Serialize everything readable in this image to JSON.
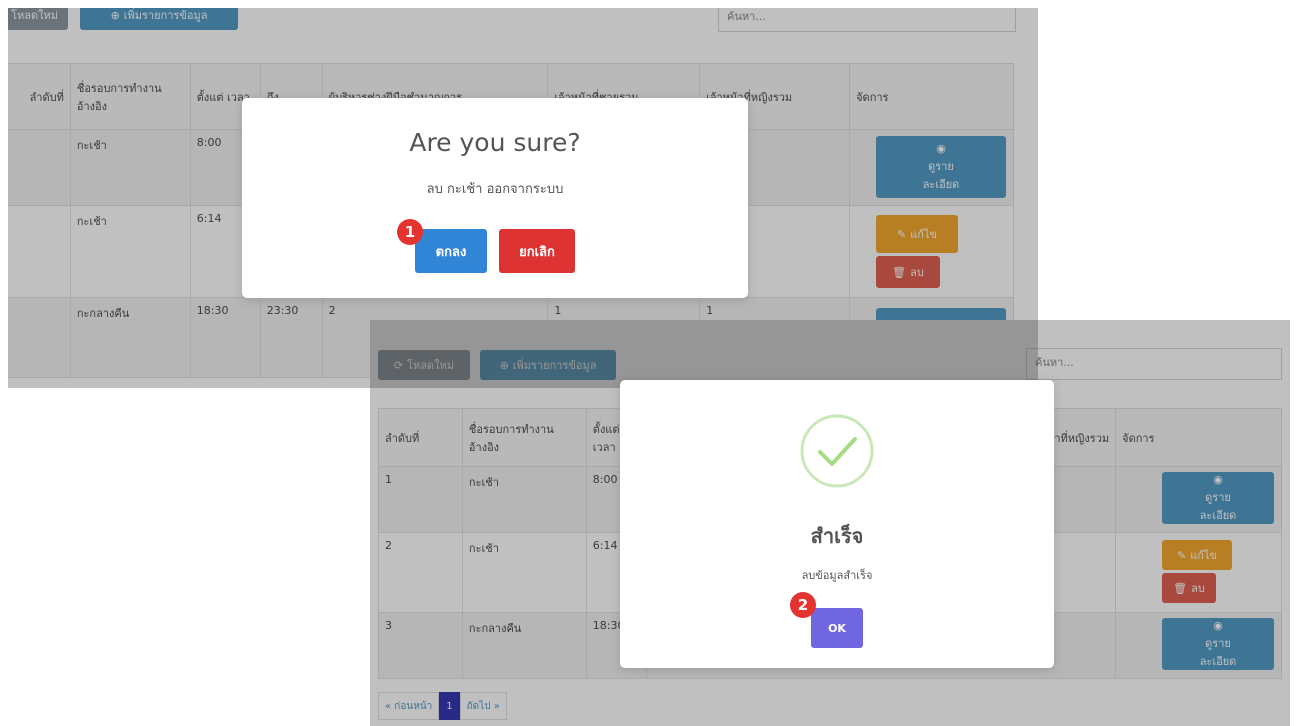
{
  "shot1": {
    "toolbar": {
      "reload_label": "โหลดใหม่",
      "add_label": "เพิ่มรายการข้อมูล"
    },
    "search_placeholder": "ค้นหา...",
    "columns": [
      "ลำดับที่",
      "ชื่อรอบการทำงาน อ้างอิง",
      "ตั้งแต่ เวลา",
      "ถึง",
      "ผู้บริหารช่างฝีมือชำนาญการ",
      "เจ้าหน้าที่ชายรวม",
      "เจ้าหน้าที่หญิงรวม",
      "จัดการ"
    ],
    "rows": [
      {
        "name": "กะเช้า",
        "start": "8:00",
        "end": "",
        "managers": "",
        "male": "",
        "female": ""
      },
      {
        "name": "กะเช้า",
        "start": "6:14",
        "end": "",
        "managers": "",
        "male": "",
        "female": ""
      },
      {
        "name": "กะกลางคืน",
        "start": "18:30",
        "end": "23:30",
        "managers": "2",
        "male": "1",
        "female": "1"
      }
    ],
    "row_actions": {
      "view_label": "ดูราย ละเอียด",
      "edit_label": "แก้ไข",
      "delete_label": "ลบ"
    },
    "modal": {
      "title": "Are you sure?",
      "text": "ลบ กะเช้า ออกจากระบบ",
      "confirm_label": "ตกลง",
      "cancel_label": "ยกเลิก",
      "step": "1"
    }
  },
  "shot2": {
    "toolbar": {
      "reload_label": "โหลดใหม่",
      "add_label": "เพิ่มรายการข้อมูล"
    },
    "search_placeholder": "ค้นหา...",
    "columns": [
      "ลำดับที่",
      "ชื่อรอบการทำงาน อ้างอิง",
      "ตั้งแต่ เวลา",
      "เจ้าหน้าที่หญิงรวม",
      "จัดการ"
    ],
    "rows": [
      {
        "index": "1",
        "name": "กะเช้า",
        "start": "8:00"
      },
      {
        "index": "2",
        "name": "กะเช้า",
        "start": "6:14"
      },
      {
        "index": "3",
        "name": "กะกลางคืน",
        "start": "18:30"
      }
    ],
    "row_actions": {
      "view_label": "ดูราย ละเอียด",
      "edit_label": "แก้ไข",
      "delete_label": "ลบ"
    },
    "pagination": {
      "prev_label": "« ก่อนหน้า",
      "current_page": "1",
      "next_label": "ถัดไป »"
    },
    "modal": {
      "title": "สำเร็จ",
      "text": "ลบข้อมูลสำเร็จ",
      "ok_label": "OK",
      "step": "2"
    }
  },
  "colors": {
    "primary": "#3085d6",
    "danger": "#dd3333",
    "confirm_ok": "#7066e0",
    "success": "#a5dc86",
    "badge": "#e3342f"
  },
  "icons": [
    "refresh-icon",
    "plus-circle-icon",
    "eye-icon",
    "edit-icon",
    "trash-icon",
    "success-check-icon"
  ]
}
